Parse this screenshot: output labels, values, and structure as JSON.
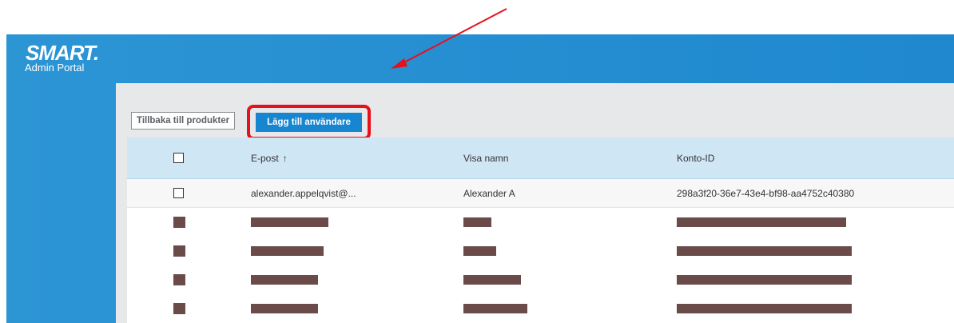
{
  "brand": {
    "wordmark": "SMART.",
    "subtitle": "Admin Portal"
  },
  "toolbar": {
    "back_label": "Tillbaka till produkter",
    "add_user_label": "Lägg till användare"
  },
  "table": {
    "columns": [
      {
        "label": "E-post",
        "sort": "ascending"
      },
      {
        "label": "Visa namn"
      },
      {
        "label": "Konto-ID"
      }
    ],
    "sort_icon": "↑",
    "rows": [
      {
        "email": "alexander.appelqvist@...",
        "display_name": "Alexander A",
        "account_id": "298a3f20-36e7-43e4-bf98-aa4752c40380"
      }
    ],
    "redacted_rows": 4
  },
  "colors": {
    "header_blue": "#2c95d4",
    "panel_gray": "#e6e8ea",
    "primary_button": "#1686d0",
    "annotation_red": "#e8101a",
    "table_header": "#cfe6f5",
    "redaction": "#6b4a4a"
  }
}
